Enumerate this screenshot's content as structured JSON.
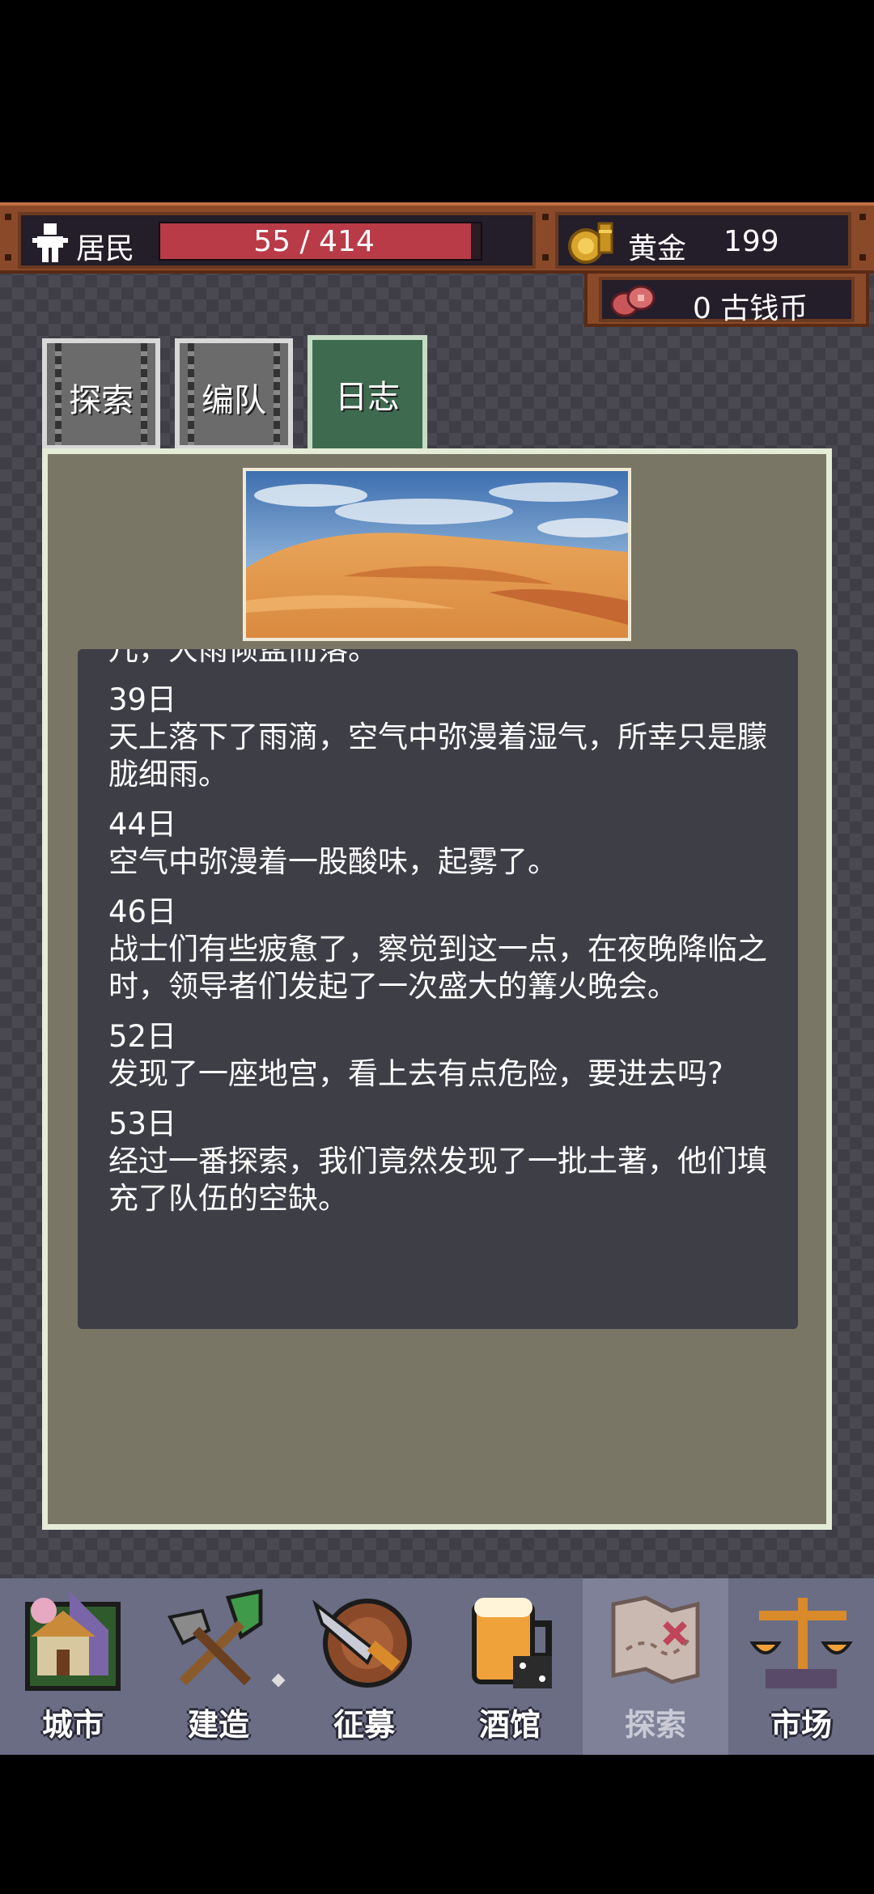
{
  "status": {
    "population": {
      "label": "居民",
      "current": 55,
      "max": 414,
      "display": "55 / 414"
    },
    "gold": {
      "label": "黄金",
      "value": "199"
    },
    "ancient_coins": {
      "display": "0 古钱币"
    }
  },
  "tabs": [
    {
      "label": "探索",
      "active": false
    },
    {
      "label": "编队",
      "active": false
    },
    {
      "label": "日志",
      "active": true
    }
  ],
  "log": {
    "partial_line": "儿，大雨倾盆而落。",
    "entries": [
      {
        "day": "39日",
        "text": "天上落下了雨滴，空气中弥漫着湿气，所幸只是朦胧细雨。"
      },
      {
        "day": "44日",
        "text": "空气中弥漫着一股酸味，起雾了。"
      },
      {
        "day": "46日",
        "text": "战士们有些疲惫了，察觉到这一点，在夜晚降临之时，领导者们发起了一次盛大的篝火晚会。"
      },
      {
        "day": "52日",
        "text": "发现了一座地宫，看上去有点危险，要进去吗?"
      },
      {
        "day": "53日",
        "text": "经过一番探索，我们竟然发现了一批土著，他们填充了队伍的空缺。"
      }
    ]
  },
  "nav": [
    {
      "label": "城市",
      "icon": "city-icon"
    },
    {
      "label": "建造",
      "icon": "shovel-icon"
    },
    {
      "label": "征募",
      "icon": "sword-shield-icon"
    },
    {
      "label": "酒馆",
      "icon": "beer-icon"
    },
    {
      "label": "探索",
      "icon": "map-icon",
      "active": true
    },
    {
      "label": "市场",
      "icon": "scales-icon"
    }
  ],
  "colors": {
    "population_bar": "#b83b47",
    "active_tab": "#3e6b4f",
    "panel_bg": "#7a7665",
    "log_bg": "#3e3e47"
  }
}
